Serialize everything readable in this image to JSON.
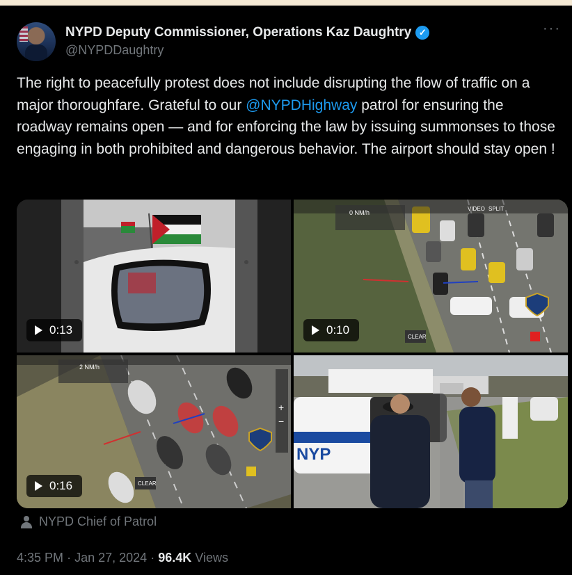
{
  "author": {
    "name": "NYPD Deputy Commissioner, Operations Kaz Daughtry",
    "handle": "@NYPDDaughtry",
    "verified": true,
    "more_label": "···"
  },
  "post": {
    "text_part1": "The right to peacefully protest does not include disrupting the flow of traffic on a major thoroughfare. Grateful to our ",
    "mention": "@NYPDHighway",
    "text_part2": " patrol for ensuring the roadway remains open — and for enforcing the law by issuing summonses to those engaging in both prohibited and dangerous behavior.  The airport should stay open !"
  },
  "media": {
    "videos": [
      {
        "duration": "0:13"
      },
      {
        "duration": "0:10"
      },
      {
        "duration": "0:16"
      }
    ],
    "overlay_texts": {
      "speed_top": "0 NM/h",
      "speed_bottom": "2 NM/h",
      "clear": "CLEAR",
      "video": "VIDEO",
      "split": "SPLIT"
    }
  },
  "attribution": "NYPD Chief of Patrol",
  "meta": {
    "time": "4:35 PM",
    "dot": "·",
    "date": "Jan 27, 2024",
    "views_count": "96.4K",
    "views_label": "Views"
  },
  "colors": {
    "background": "#000000",
    "text": "#e7e9ea",
    "secondary": "#71767b",
    "accent": "#1d9bf0",
    "page_bg": "#f5e9d4"
  }
}
